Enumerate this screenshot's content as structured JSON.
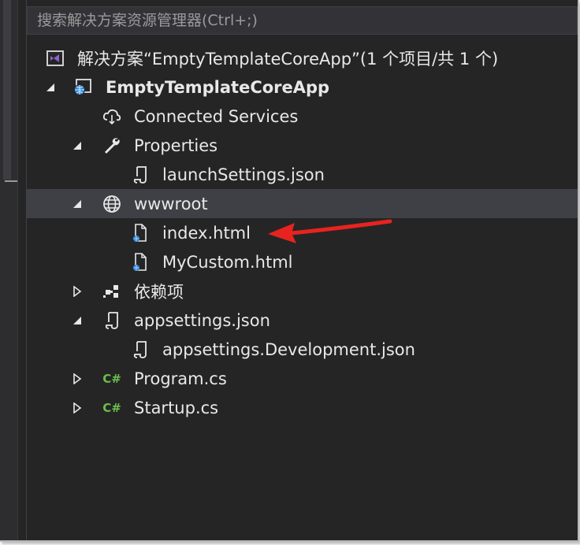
{
  "search": {
    "placeholder": "搜索解决方案资源管理器(Ctrl+;)"
  },
  "tree": {
    "solution": "解决方案“EmptyTemplateCoreApp”(1 个项目/共 1 个)",
    "project": "EmptyTemplateCoreApp",
    "connected_services": "Connected Services",
    "properties": "Properties",
    "launch_settings": "launchSettings.json",
    "wwwroot": "wwwroot",
    "index_html": "index.html",
    "my_custom_html": "MyCustom.html",
    "dependencies": "依赖项",
    "appsettings": "appsettings.json",
    "appsettings_dev": "appsettings.Development.json",
    "program_cs": "Program.cs",
    "startup_cs": "Startup.cs",
    "csharp_badge": "C#"
  },
  "colors": {
    "panel_bg": "#252526",
    "text": "#e8e8e8",
    "selected_row": "#3f3f46",
    "csharp_green": "#6abf4b",
    "vs_purple": "#8b63c9",
    "web_blue": "#2f86d6",
    "annotation_arrow": "#e8231f"
  }
}
